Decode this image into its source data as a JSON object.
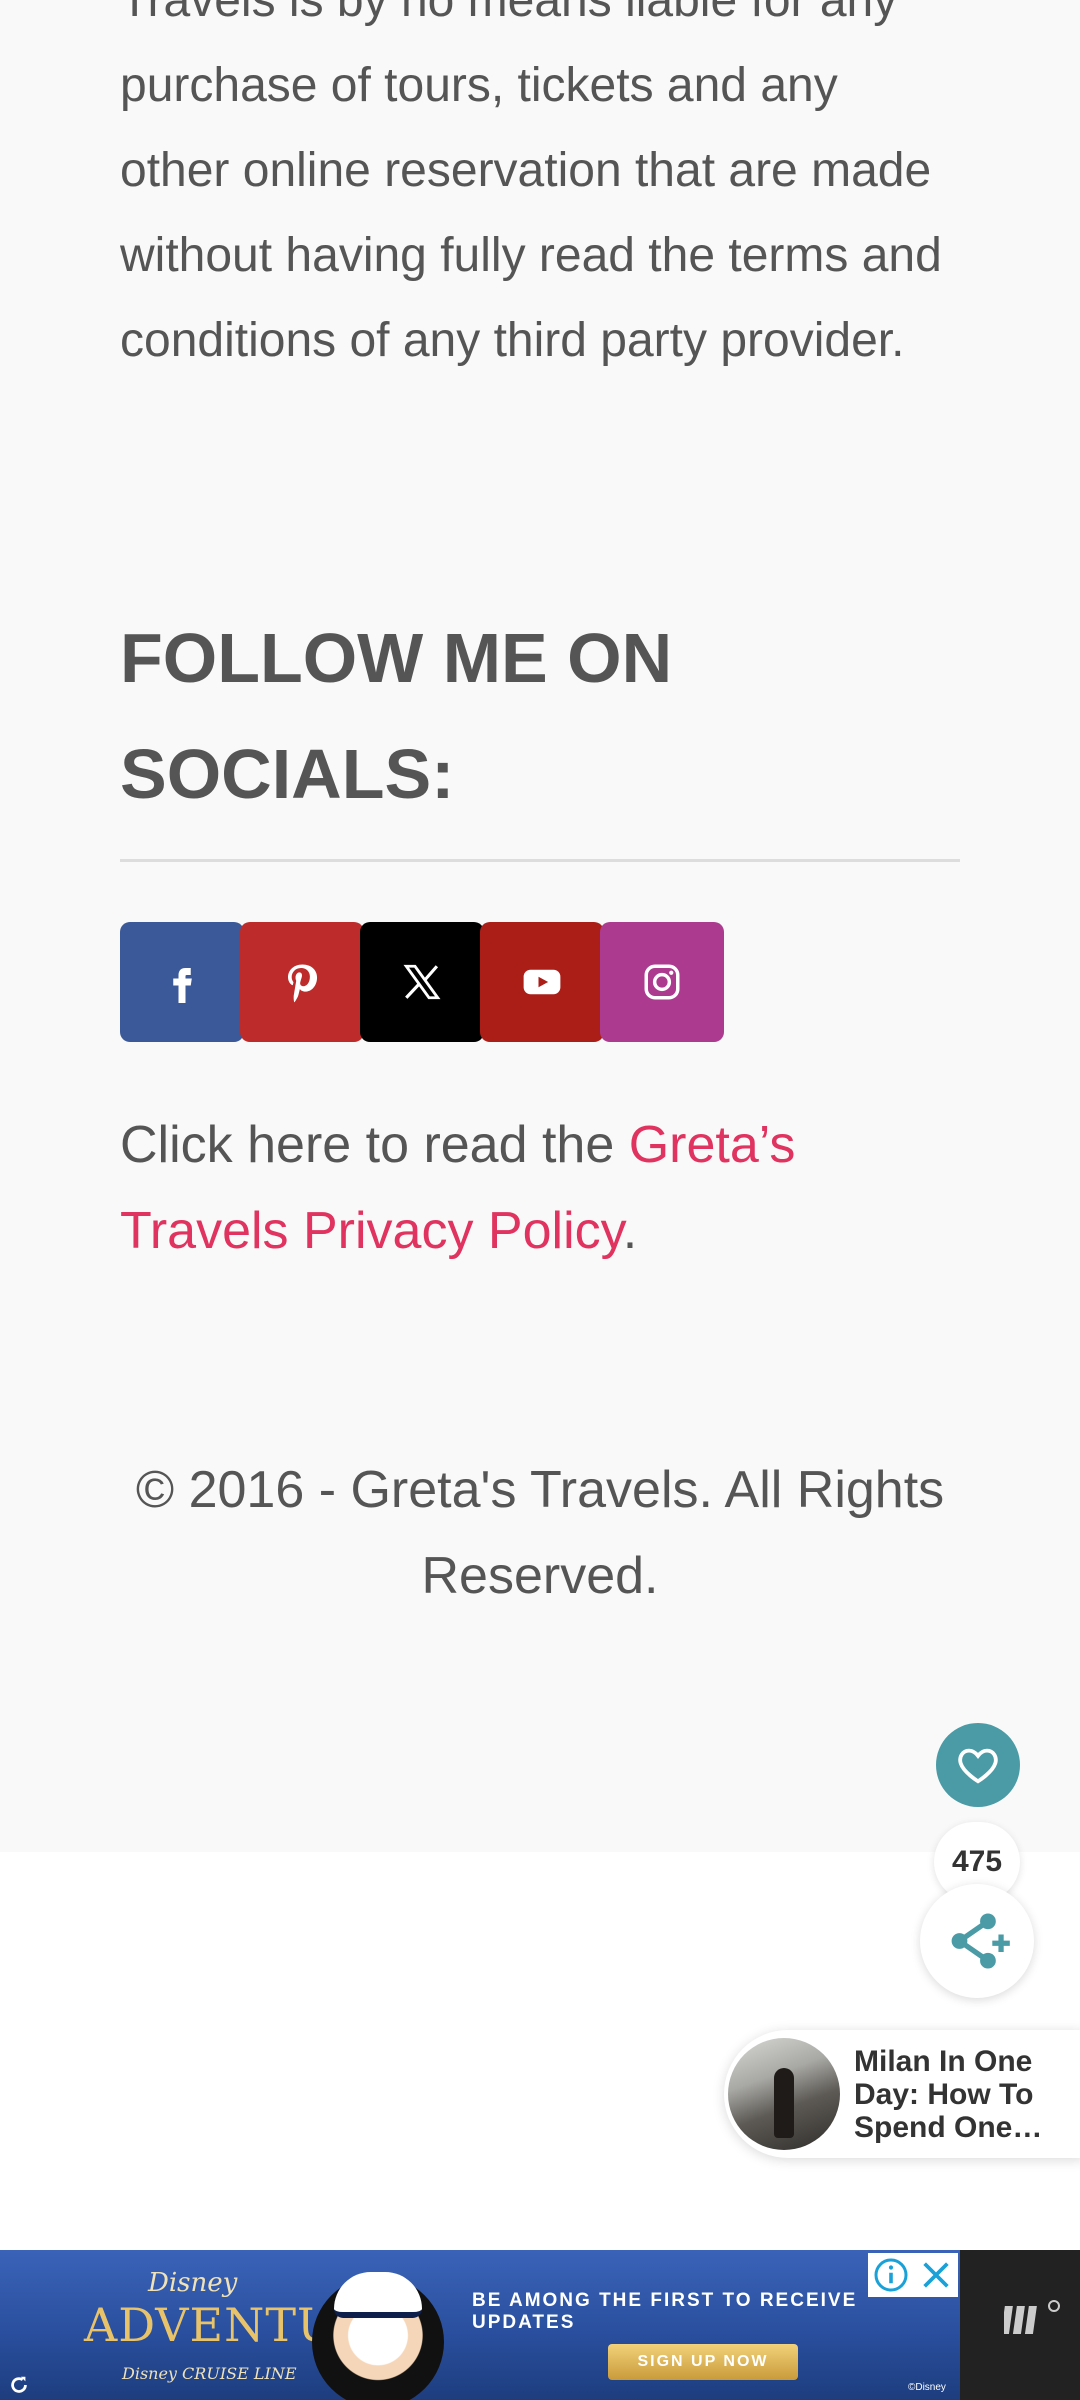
{
  "article": {
    "disclaimer_text": "Travels is by no means liable for any purchase of tours, tickets and any other online reservation that are made without having fully read the terms and conditions of any third party provider."
  },
  "follow": {
    "title": "FOLLOW ME ON SOCIALS:",
    "buttons": [
      {
        "name": "facebook",
        "icon": "facebook-icon",
        "color": "#3b5998"
      },
      {
        "name": "pinterest",
        "icon": "pinterest-icon",
        "color": "#bd2b2b"
      },
      {
        "name": "x",
        "icon": "x-icon",
        "color": "#000000"
      },
      {
        "name": "youtube",
        "icon": "youtube-icon",
        "color": "#ab1e17"
      },
      {
        "name": "instagram",
        "icon": "instagram-icon",
        "color": "#ac3a8f"
      }
    ]
  },
  "privacy": {
    "prefix": "Click here to read the ",
    "link_text": "Greta’s Travels Privacy Policy",
    "suffix": "."
  },
  "footer": {
    "copyright": "© 2016 - Greta's Travels. All Rights Reserved."
  },
  "share_widget": {
    "count": "475",
    "heart_icon": "heart-icon",
    "share_icon": "share-icon",
    "accent_color": "#4a9ba6"
  },
  "related": {
    "title": "Milan In One Day: How To Spend One…"
  },
  "ad": {
    "brand_small": "Disney",
    "brand_big": "ADVENTURE",
    "brand_sub": "Disney CRUISE LINE",
    "headline": "BE AMONG THE FIRST TO RECEIVE UPDATES",
    "cta": "SIGN UP NOW",
    "copyright": "©Disney"
  }
}
